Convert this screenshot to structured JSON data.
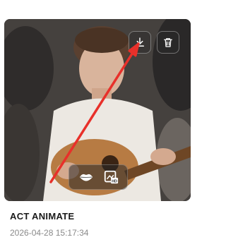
{
  "card": {
    "title": "ACT ANIMATE",
    "timestamp": "2026-04-28 15:17:34"
  },
  "actions": {
    "download_icon": "download-icon",
    "delete_icon": "trash-icon"
  },
  "tools": [
    {
      "icon": "lips-icon"
    },
    {
      "icon": "hd-enhance-icon",
      "badge": "HD"
    }
  ],
  "colors": {
    "annotation_arrow": "#e8302a",
    "title": "#1a1a1a",
    "timestamp": "#8a8a8a"
  }
}
